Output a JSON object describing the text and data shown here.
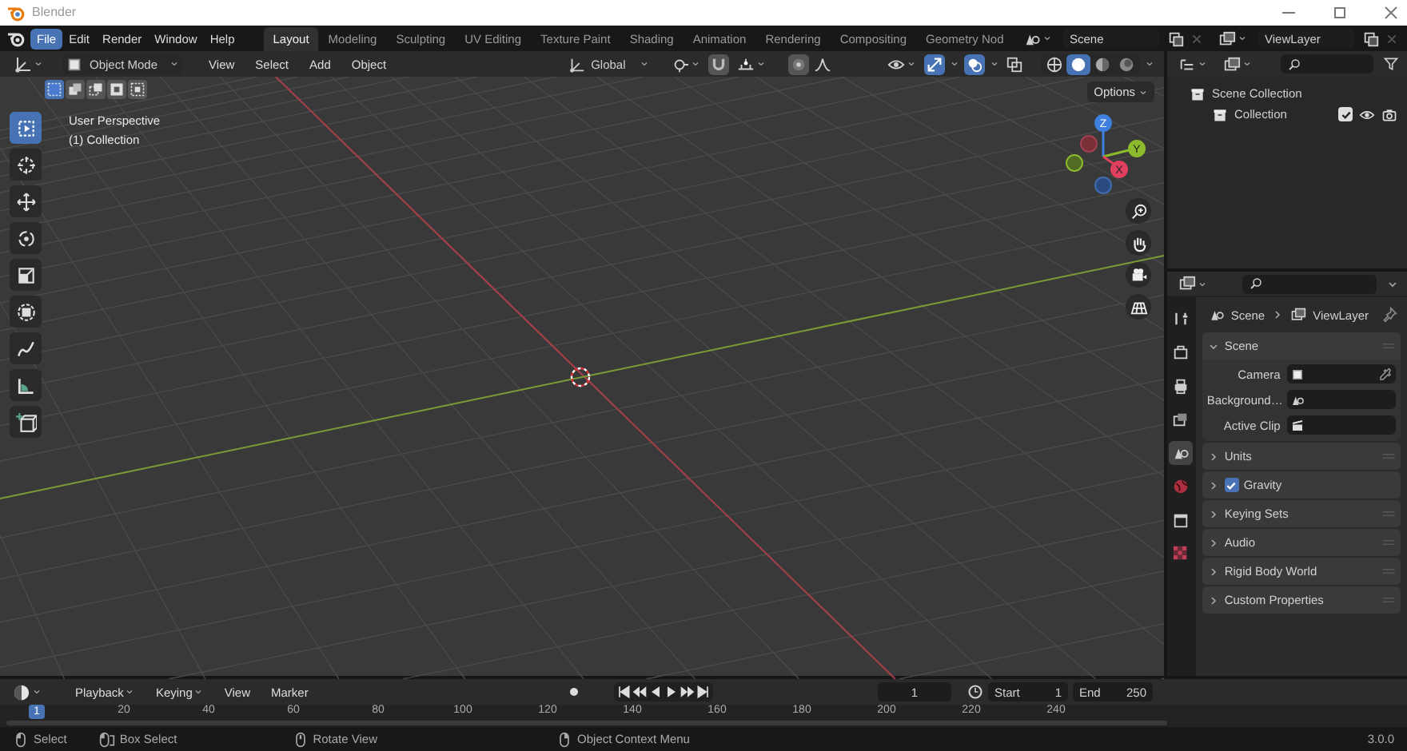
{
  "window": {
    "title": "Blender"
  },
  "menu_bar": [
    {
      "label": "File",
      "selected": true
    },
    {
      "label": "Edit",
      "selected": false
    },
    {
      "label": "Render",
      "selected": false
    },
    {
      "label": "Window",
      "selected": false
    },
    {
      "label": "Help",
      "selected": false
    }
  ],
  "workspace_tabs": [
    {
      "label": "Layout",
      "selected": true
    },
    {
      "label": "Modeling",
      "selected": false
    },
    {
      "label": "Sculpting",
      "selected": false
    },
    {
      "label": "UV Editing",
      "selected": false
    },
    {
      "label": "Texture Paint",
      "selected": false
    },
    {
      "label": "Shading",
      "selected": false
    },
    {
      "label": "Animation",
      "selected": false
    },
    {
      "label": "Rendering",
      "selected": false
    },
    {
      "label": "Compositing",
      "selected": false
    },
    {
      "label": "Geometry Nod",
      "selected": false
    }
  ],
  "scene_field": {
    "value": "Scene"
  },
  "view_layer_field": {
    "value": "ViewLayer"
  },
  "viewport": {
    "mode": "Object Mode",
    "menus": [
      "View",
      "Select",
      "Add",
      "Object"
    ],
    "orientation": "Global",
    "toggles": [
      {
        "kind": "gizmos",
        "on": true
      },
      {
        "kind": "overlays",
        "on": true
      },
      {
        "kind": "xray",
        "on": false
      }
    ],
    "shading": [
      {
        "kind": "wireframe",
        "selected": false
      },
      {
        "kind": "solid",
        "selected": true
      },
      {
        "kind": "material",
        "selected": false
      },
      {
        "kind": "rendered",
        "selected": false
      }
    ],
    "select_modes": [
      {
        "kind": "set",
        "selected": true
      },
      {
        "kind": "extend",
        "selected": false
      },
      {
        "kind": "subtract",
        "selected": false
      },
      {
        "kind": "invert",
        "selected": false
      },
      {
        "kind": "intersect",
        "selected": false
      }
    ],
    "options": "Options",
    "overlay_text": [
      "User Perspective",
      "(1) Collection"
    ],
    "tools": [
      {
        "kind": "select",
        "selected": true
      },
      {
        "kind": "cursor",
        "selected": false
      },
      {
        "kind": "move",
        "selected": false
      },
      {
        "kind": "rotate",
        "selected": false
      },
      {
        "kind": "scale",
        "selected": false
      },
      {
        "kind": "transform",
        "selected": false
      },
      {
        "kind": "annotate",
        "selected": false
      },
      {
        "kind": "measure",
        "selected": false
      },
      {
        "kind": "add-cube",
        "selected": false
      }
    ],
    "gizmo_labels": [
      "Z",
      "Y",
      "X"
    ]
  },
  "outliner": {
    "tree": [
      {
        "label": "Scene Collection",
        "children": [
          {
            "label": "Collection",
            "checked": true
          }
        ]
      }
    ]
  },
  "properties": {
    "tabs": [
      {
        "kind": "tool",
        "selected": false
      },
      {
        "kind": "render",
        "selected": false
      },
      {
        "kind": "output",
        "selected": false
      },
      {
        "kind": "view-layer",
        "selected": false
      },
      {
        "kind": "scene",
        "selected": true
      },
      {
        "kind": "world",
        "selected": false
      },
      {
        "kind": "collection",
        "selected": false
      },
      {
        "kind": "texture",
        "selected": false
      }
    ],
    "breadcrumb": [
      "Scene",
      "ViewLayer"
    ],
    "panels": [
      {
        "kind": "panel",
        "label": "Scene",
        "expanded": true,
        "fields": [
          {
            "kind": "camera",
            "label": "Camera"
          },
          {
            "kind": "background",
            "label": "Background…"
          },
          {
            "kind": "clip",
            "label": "Active Clip"
          }
        ]
      },
      {
        "kind": "panel",
        "label": "Units",
        "expanded": false
      },
      {
        "kind": "checkbox",
        "label": "Gravity",
        "expanded": false,
        "checked": true
      },
      {
        "kind": "panel",
        "label": "Keying Sets",
        "expanded": false
      },
      {
        "kind": "panel",
        "label": "Audio",
        "expanded": false
      },
      {
        "kind": "panel",
        "label": "Rigid Body World",
        "expanded": false
      },
      {
        "kind": "panel",
        "label": "Custom Properties",
        "expanded": false
      }
    ]
  },
  "timeline": {
    "menus": [
      "Playback",
      "Keying",
      "View",
      "Marker"
    ],
    "current_frame": "1",
    "start_label": "Start",
    "start": "1",
    "end_label": "End",
    "end": "250",
    "playhead": "1",
    "ruler": [
      "20",
      "40",
      "60",
      "80",
      "100",
      "120",
      "140",
      "160",
      "180",
      "200",
      "220",
      "240"
    ]
  },
  "status_bar": {
    "hints": [
      {
        "kind": "left-mouse",
        "label": "Select"
      },
      {
        "kind": "drag",
        "label": "Box Select"
      },
      {
        "kind": "middle-mouse",
        "label": "Rotate View"
      },
      {
        "kind": "right-mouse",
        "label": "Object Context Menu"
      }
    ],
    "version": "3.0.0"
  }
}
